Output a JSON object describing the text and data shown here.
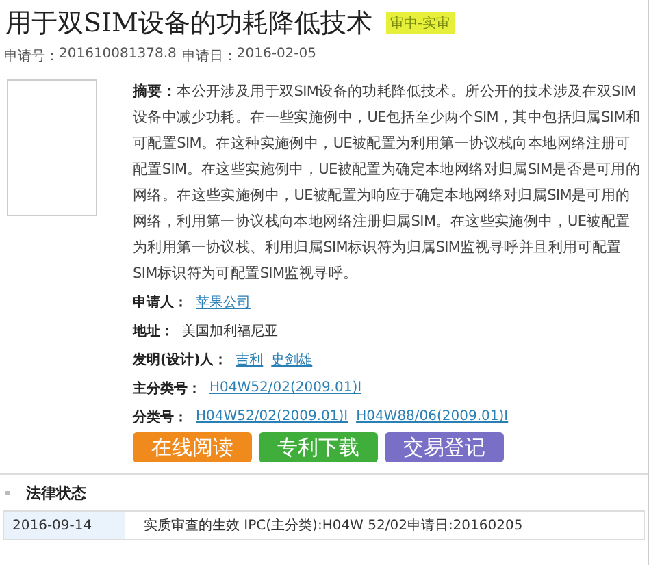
{
  "title": "用于双SIM设备的功耗降低技术",
  "status_badge": "审中-实审",
  "meta": [
    {
      "label": "申请号：",
      "value": "201610081378.8"
    },
    {
      "label": "申请日：",
      "value": "2016-02-05"
    }
  ],
  "abstract": {
    "label": "摘要：",
    "text": "本公开涉及用于双SIM设备的功耗降低技术。所公开的技术涉及在双SIM设备中减少功耗。在一些实施例中，UE包括至少两个SIM，其中包括归属SIM和可配置SIM。在这种实施例中，UE被配置为利用第一协议栈向本地网络注册可配置SIM。在这些实施例中，UE被配置为确定本地网络对归属SIM是否是可用的网络。在这些实施例中，UE被配置为响应于确定本地网络对归属SIM是可用的网络，利用第一协议栈向本地网络注册归属SIM。在这些实施例中，UE被配置为利用第一协议栈、利用归属SIM标识符为归属SIM监视寻呼并且利用可配置SIM标识符为可配置SIM监视寻呼。"
  },
  "fields": [
    {
      "label": "申请人：",
      "links": [
        "苹果公司"
      ]
    },
    {
      "label": "地址：",
      "text": "美国加利福尼亚"
    },
    {
      "label": "发明(设计)人：",
      "links": [
        "吉利",
        "史剑雄"
      ]
    },
    {
      "label": "主分类号：",
      "links": [
        "H04W52/02(2009.01)I"
      ]
    },
    {
      "label": "分类号：",
      "links": [
        "H04W52/02(2009.01)I",
        "H04W88/06(2009.01)I"
      ]
    }
  ],
  "buttons": [
    {
      "label": "在线阅读",
      "color": "#f08a1c"
    },
    {
      "label": "专利下载",
      "color": "#3fae3a"
    },
    {
      "label": "交易登记",
      "color": "#7a6fc6"
    }
  ],
  "legal_status": {
    "heading": "法律状态",
    "rows": [
      {
        "date": "2016-09-14",
        "event": "实质审查的生效 IPC(主分类):H04W 52/02申请日:20160205"
      }
    ]
  }
}
